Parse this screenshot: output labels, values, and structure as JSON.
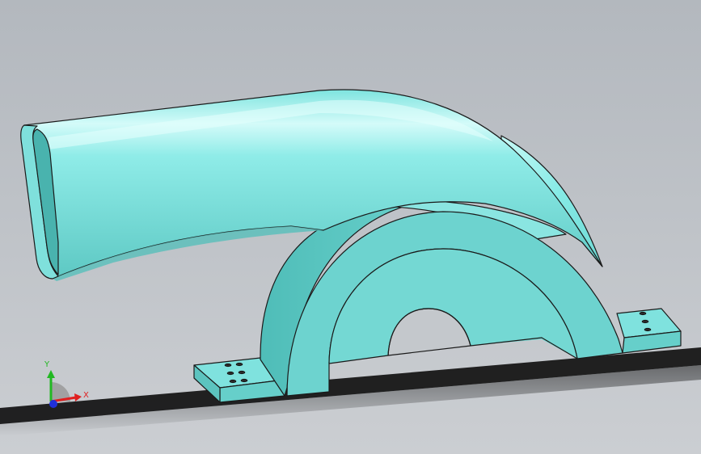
{
  "viewport": {
    "background_top": "#b4b9bf",
    "background_bottom": "#c9ccd0",
    "model_color": "#7fe3e0",
    "model_color_light": "#c8faf8",
    "model_color_shade": "#5fc7c3",
    "edge_color": "#1a1a1a",
    "floor_shadow_color": "#111111"
  },
  "triad": {
    "x_label": "X",
    "y_label": "Y",
    "x_color": "#e02020",
    "y_color": "#22b822",
    "z_color": "#2030d8"
  }
}
